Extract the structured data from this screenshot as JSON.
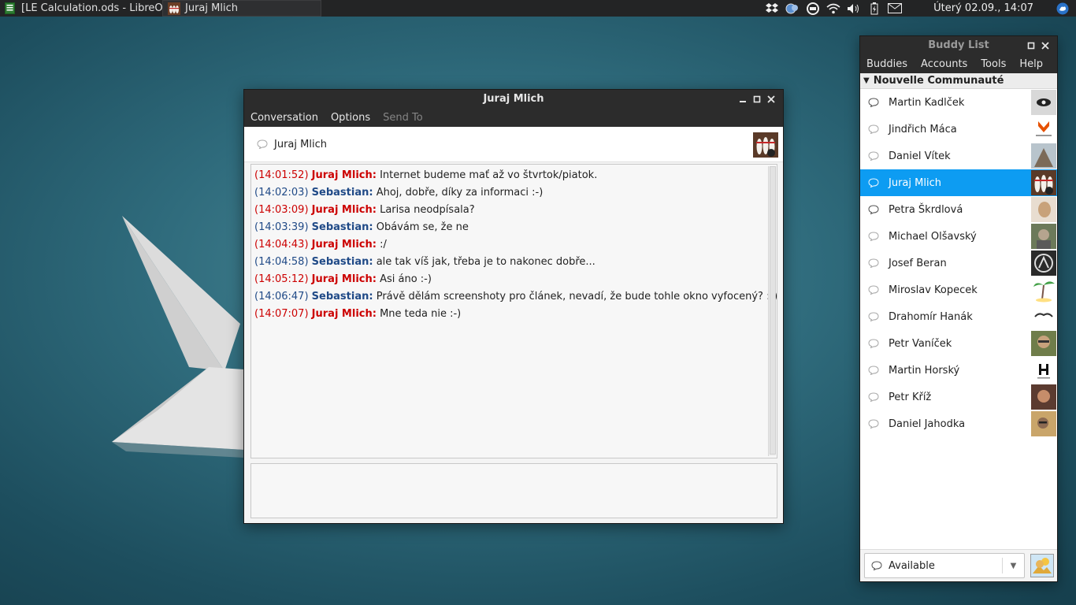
{
  "panel": {
    "tasks": [
      {
        "label": "[LE Calculation.ods - LibreO..."
      },
      {
        "label": "Juraj Mlich"
      }
    ],
    "clock": "Úterý 02.09., 14:07"
  },
  "chat": {
    "title": "Juraj Mlich",
    "menu": {
      "conversation": "Conversation",
      "options": "Options",
      "send_to": "Send To"
    },
    "header_name": "Juraj Mlich",
    "messages": [
      {
        "time": "(14:01:52)",
        "nick": "Juraj Mlich:",
        "text": "Internet budeme mať až vo štvrtok/piatok."
      },
      {
        "time": "(14:02:03)",
        "nick": "Sebastian:",
        "text": "Ahoj, dobře, díky za informaci :-)"
      },
      {
        "time": "(14:03:09)",
        "nick": "Juraj Mlich:",
        "text": "Larisa neodpísala?"
      },
      {
        "time": "(14:03:39)",
        "nick": "Sebastian:",
        "text": "Obávám se, že ne"
      },
      {
        "time": "(14:04:43)",
        "nick": "Juraj Mlich:",
        "text": ":/"
      },
      {
        "time": "(14:04:58)",
        "nick": "Sebastian:",
        "text": "ale tak víš jak, třeba je to nakonec dobře..."
      },
      {
        "time": "(14:05:12)",
        "nick": "Juraj Mlich:",
        "text": "Asi áno :-)"
      },
      {
        "time": "(14:06:47)",
        "nick": "Sebastian:",
        "text": "Právě dělám screenshoty pro článek, nevadí, že bude tohle okno vyfocený? :-)"
      },
      {
        "time": "(14:07:07)",
        "nick": "Juraj Mlich:",
        "text": "Mne teda nie :-)"
      }
    ]
  },
  "buddy_list": {
    "title": "Buddy List",
    "menu": {
      "buddies": "Buddies",
      "accounts": "Accounts",
      "tools": "Tools",
      "help": "Help"
    },
    "group": "Nouvelle Communauté",
    "buddies": [
      {
        "name": "Martin Kadlček"
      },
      {
        "name": "Jindřich Máca"
      },
      {
        "name": "Daniel Vítek"
      },
      {
        "name": "Juraj Mlich"
      },
      {
        "name": "Petra Škrdlová"
      },
      {
        "name": "Michael Olšavský"
      },
      {
        "name": "Josef Beran"
      },
      {
        "name": "Miroslav Kopecek"
      },
      {
        "name": "Drahomír Hanák"
      },
      {
        "name": "Petr Vaníček"
      },
      {
        "name": "Martin Horský"
      },
      {
        "name": "Petr Kříž"
      },
      {
        "name": "Daniel Jahodka"
      }
    ],
    "selected_index": 3,
    "status": "Available"
  },
  "colors": {
    "own_nick": "#cc0000",
    "other_nick": "#204a87",
    "selection": "#0d9cf2",
    "titlebar": "#2c2c2c"
  }
}
